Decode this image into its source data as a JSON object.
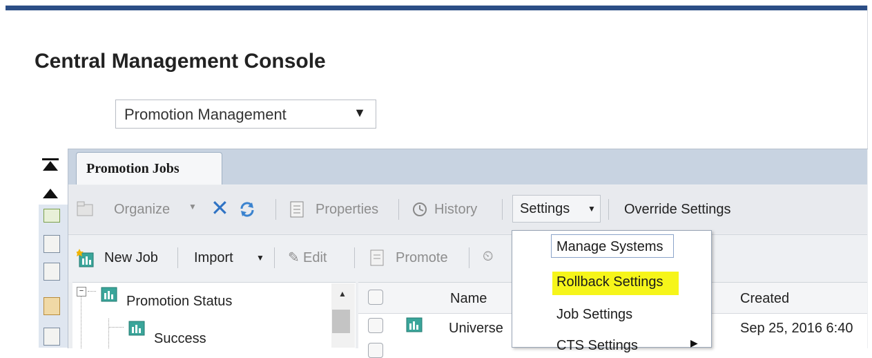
{
  "app": {
    "title": "Central Management Console"
  },
  "area_select": {
    "value": "Promotion Management"
  },
  "tab": {
    "label": "Promotion Jobs"
  },
  "toolbar1": {
    "organize": "Organize",
    "properties": "Properties",
    "history": "History",
    "settings": "Settings",
    "override": "Override Settings"
  },
  "toolbar2": {
    "new_job": "New Job",
    "import": "Import",
    "edit": "Edit",
    "promote": "Promote"
  },
  "settings_menu": {
    "items": [
      "Manage Systems",
      "Rollback Settings",
      "Job Settings",
      "CTS Settings"
    ]
  },
  "tree": {
    "root": "Promotion Status",
    "child": "Success"
  },
  "list": {
    "columns": {
      "name": "Name",
      "created": "Created"
    },
    "rows": [
      {
        "name": "Universe",
        "created": "Sep 25, 2016 6:40"
      }
    ]
  },
  "colors": {
    "brand_bar": "#2c4e86",
    "highlight": "#f6f51a",
    "tab_strip": "#c8d3e1"
  }
}
